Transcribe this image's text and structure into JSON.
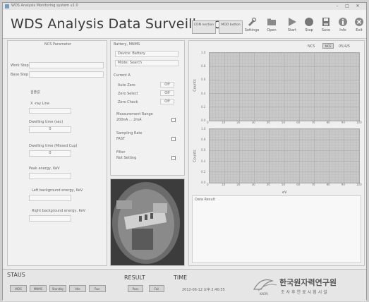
{
  "window": {
    "title": "WDS Analysis Monitoring system v1.0"
  },
  "header": {
    "title": "WDS Analysis Data Surveillance",
    "btn_con": "CON\nnection",
    "btn_mod": "MOD\nbutton",
    "tools": [
      {
        "name": "settings",
        "label": "Settings",
        "icon": "tools-icon"
      },
      {
        "name": "open",
        "label": "Open",
        "icon": "folder-icon"
      },
      {
        "name": "start",
        "label": "Start",
        "icon": "play-icon"
      },
      {
        "name": "stop",
        "label": "Stop",
        "icon": "stop-icon"
      },
      {
        "name": "save",
        "label": "Save",
        "icon": "save-icon"
      },
      {
        "name": "info",
        "label": "Info",
        "icon": "info-icon"
      },
      {
        "name": "exit",
        "label": "Exit",
        "icon": "exit-icon"
      }
    ]
  },
  "left": {
    "header": "NCS Parameter",
    "work_step": "Work Step",
    "work_step_val": "",
    "base_step": "Base Step",
    "base_step_val": "",
    "group_label": "검출값",
    "x_ray_line": "X -ray Line",
    "dwelling_label": "Dwelling time (sec)",
    "dwelling_val": "0",
    "overlap_label": "Dwelling time (Missed Cup)",
    "overlap_val": "0",
    "peak_energy": "Peak energy, KeV",
    "left_bg": "Left background energy, KeV",
    "right_bg": "Right background energy, KeV"
  },
  "mid": {
    "header": "Battery, MNMS",
    "device": "Device: Battery",
    "mode": "Mode: Search",
    "current": "Current A",
    "auto_zero": "Auto Zero",
    "auto_zero_val": "Off",
    "zero_select": "Zero Select",
    "zero_select_val": "Off",
    "zero_check": "Zero Check",
    "zero_check_val": "Off",
    "range_label": "Measurement Range",
    "range_val": "200nA ... 2mA",
    "rate_label": "Sampling Rate",
    "rate_val": "FAST",
    "filter_label": "Filter",
    "filter_val": "Not Setting"
  },
  "right": {
    "top_label": "NCS",
    "top_btn": "NCS",
    "top_right": "05/4/5",
    "chart1_ylabel": "Counts",
    "chart1_xticks": [
      "0",
      "10",
      "20",
      "30",
      "40",
      "50",
      "60",
      "70",
      "80",
      "90",
      "100"
    ],
    "chart1_yticks": [
      "1.0",
      "0.8",
      "0.6",
      "0.4",
      "0.2",
      "0.0"
    ],
    "chart2_ylabel": "Counts",
    "chart2_xticks": [
      "0",
      "10",
      "20",
      "30",
      "40",
      "50",
      "60",
      "70",
      "80",
      "90",
      "100"
    ],
    "chart2_xlabel": "eV",
    "chart2_yticks": [
      "1.0",
      "0.8",
      "0.6",
      "0.4",
      "0.2",
      "0.0"
    ],
    "data_result": "Data Result"
  },
  "status": {
    "status_title": "STAUS",
    "status_btns": [
      "WDS",
      "MNMS",
      "Standby",
      "Idle",
      "Run"
    ],
    "result_title": "RESULT",
    "result_btns": [
      "Pass",
      "Fail"
    ],
    "time_title": "TIME",
    "time_val": "2012-06-12 오후 2:40:55",
    "org_name": "한국원자력연구원",
    "org_sub": "조사후연료시험시설",
    "org_abbr": "KAERI"
  }
}
